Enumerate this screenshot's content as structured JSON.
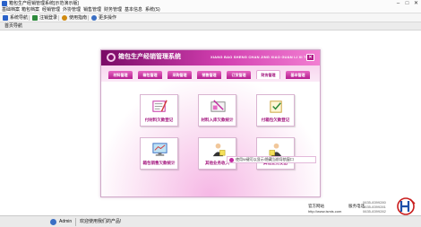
{
  "window": {
    "title": "箱包生产经销管理系统[示范演示版]"
  },
  "menubar": {
    "items": [
      "基础档案",
      "箱包档案",
      "经销管理",
      "外协管理",
      "销售管理",
      "财务管理",
      "基本信息",
      "系统(S)"
    ]
  },
  "toolbar": {
    "items": [
      {
        "label": "系统导航",
        "icon": "navigation-icon",
        "color": "#2a62c9"
      },
      {
        "label": "注销登录",
        "icon": "logout-icon",
        "color": "#2e8b3d"
      },
      {
        "label": "使用指南",
        "icon": "help-icon",
        "color": "#d08a10"
      },
      {
        "label": "更多操作",
        "icon": "more-icon",
        "color": "#3a6fc4"
      }
    ]
  },
  "desktop_tab": {
    "label": "首页导航"
  },
  "banner": {
    "title": "箱包生产经销管理系统",
    "pinyin": "XIANG BAO SHENG CHAN JING XIAO GUAN LI XI TONG",
    "close": "✕"
  },
  "tabs": [
    {
      "label": "材料管理",
      "active": false
    },
    {
      "label": "箱包管理",
      "active": false
    },
    {
      "label": "采购管理",
      "active": false
    },
    {
      "label": "销售管理",
      "active": false
    },
    {
      "label": "订货管理",
      "active": false
    },
    {
      "label": "财务管理",
      "active": true
    },
    {
      "label": "基本管理",
      "active": false
    }
  ],
  "tiles": [
    {
      "label": "付材料欠款登记",
      "icon": "payment-icon"
    },
    {
      "label": "材料入库欠款统计",
      "icon": "inventory-debt-icon"
    },
    {
      "label": "付箱包欠款登记",
      "icon": "bag-payment-icon"
    },
    {
      "label": "箱包销售欠款统计",
      "icon": "sales-debt-stats-icon"
    },
    {
      "label": "其他业务收入",
      "icon": "other-income-icon"
    },
    {
      "label": "其他业务支出",
      "icon": "other-expense-icon"
    }
  ],
  "notice": {
    "text": "使用W键可以显示/隐藏当前导航窗口"
  },
  "footer": {
    "site_label": "官方网站",
    "site_url": "http://www.ismis.com",
    "phone_label": "服务电话",
    "phones": [
      "0635-8399280",
      "0635-8399281",
      "0635-8399282"
    ]
  },
  "statusbar": {
    "user": "Admin",
    "message": "欢迎使用我们的产品!"
  },
  "colors": {
    "accent": "#c12aa0",
    "banner_dark": "#7a0b66",
    "tab_text": "#a3167e"
  }
}
